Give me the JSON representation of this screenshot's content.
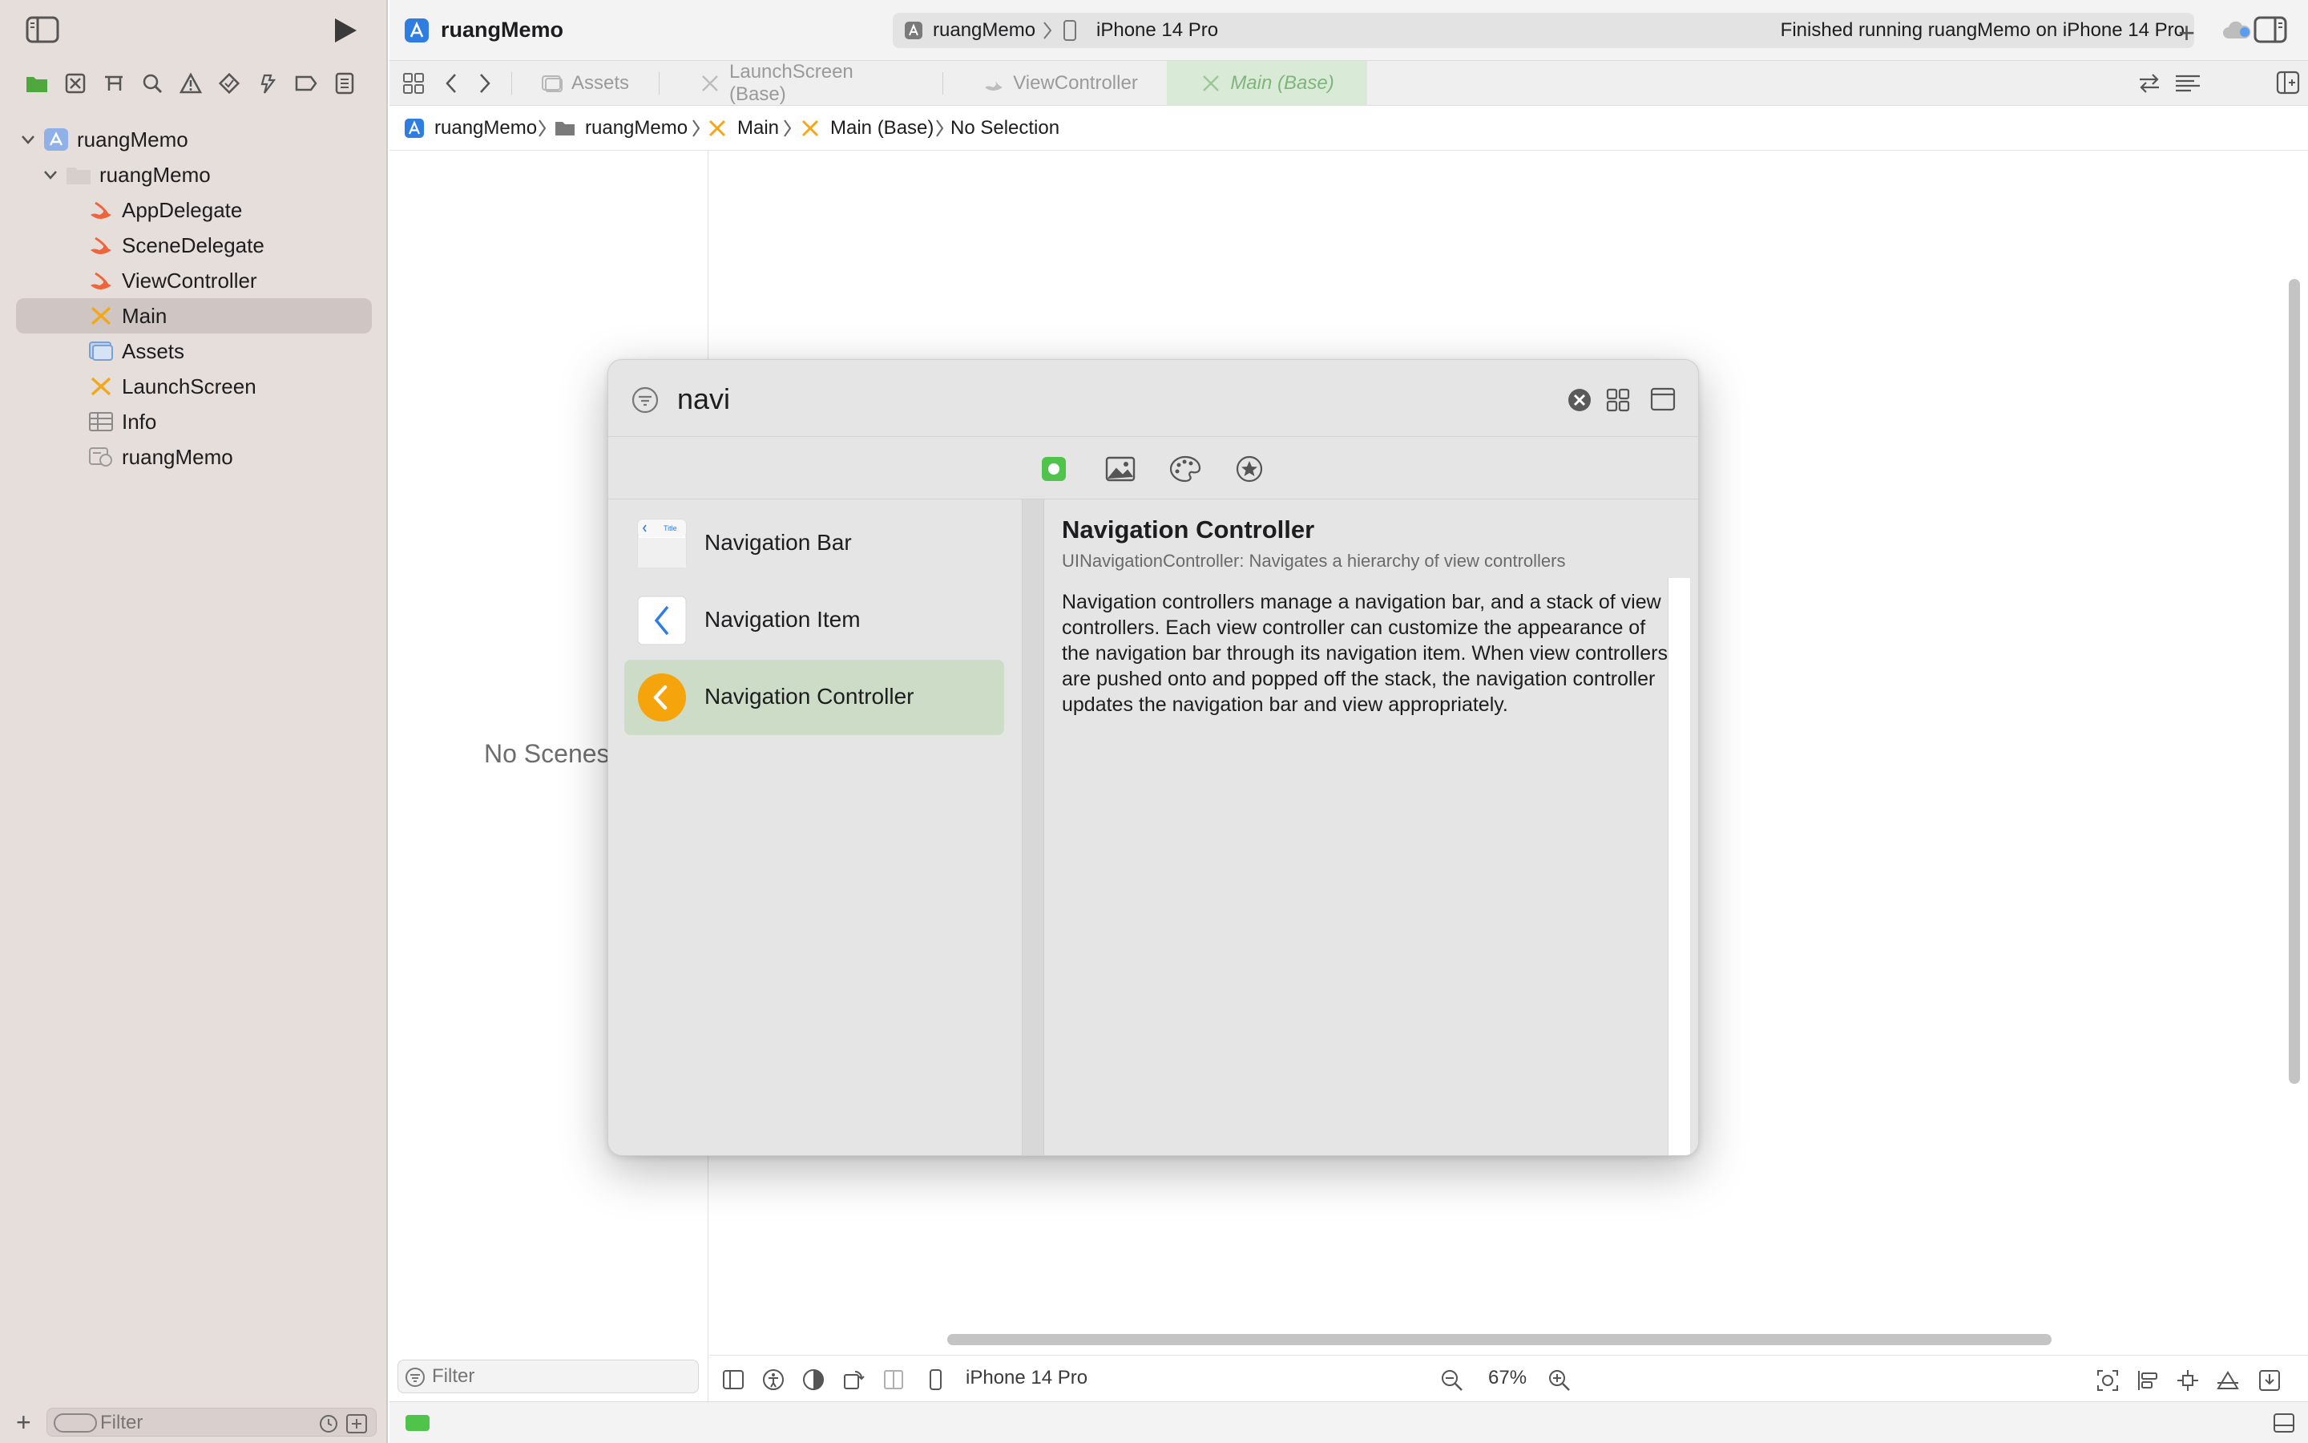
{
  "window": {
    "project_title": "ruangMemo",
    "scheme": {
      "project": "ruangMemo",
      "device": "iPhone 14 Pro",
      "status": "Finished running ruangMemo on iPhone 14 Pro"
    }
  },
  "sidebar": {
    "tree": [
      {
        "label": "ruangMemo",
        "type": "project",
        "expanded": true
      },
      {
        "label": "ruangMemo",
        "type": "folder",
        "expanded": true
      },
      {
        "label": "AppDelegate",
        "type": "swift"
      },
      {
        "label": "SceneDelegate",
        "type": "swift"
      },
      {
        "label": "ViewController",
        "type": "swift"
      },
      {
        "label": "Main",
        "type": "storyboard",
        "selected": true
      },
      {
        "label": "Assets",
        "type": "assets"
      },
      {
        "label": "LaunchScreen",
        "type": "storyboard"
      },
      {
        "label": "Info",
        "type": "plist"
      },
      {
        "label": "ruangMemo",
        "type": "entitlements"
      }
    ],
    "filter_placeholder": "Filter"
  },
  "tabs": [
    {
      "label": "Assets",
      "icon": "assets-icon"
    },
    {
      "label": "LaunchScreen (Base)",
      "icon": "storyboard-icon"
    },
    {
      "label": "ViewController",
      "icon": "swift-icon"
    },
    {
      "label": "Main (Base)",
      "icon": "storyboard-icon",
      "active": true
    }
  ],
  "breadcrumb": {
    "items": [
      {
        "label": "ruangMemo",
        "icon": "app-icon"
      },
      {
        "label": "ruangMemo",
        "icon": "folder-icon"
      },
      {
        "label": "Main",
        "icon": "storyboard-icon"
      },
      {
        "label": "Main (Base)",
        "icon": "storyboard-icon"
      },
      {
        "label": "No Selection",
        "icon": ""
      }
    ]
  },
  "outline": {
    "empty_text": "No Scenes",
    "filter_placeholder": "Filter"
  },
  "canvas_bottom": {
    "device": "iPhone 14 Pro",
    "zoom": "67%"
  },
  "library": {
    "search_value": "navi",
    "items": [
      {
        "label": "Navigation Bar",
        "icon": "navigation-bar-icon",
        "icon_text": "Title"
      },
      {
        "label": "Navigation Item",
        "icon": "navigation-item-icon"
      },
      {
        "label": "Navigation Controller",
        "icon": "navigation-controller-icon",
        "selected": true
      }
    ],
    "detail": {
      "title": "Navigation Controller",
      "subtitle": "UINavigationController: Navigates a hierarchy of view controllers",
      "body": "Navigation controllers manage a navigation bar, and a stack of view controllers. Each view controller can customize the appearance of the navigation bar through its navigation item. When view controllers are pushed onto and popped off the stack, the navigation controller updates the navigation bar and view appropriately."
    }
  },
  "colors": {
    "accent_orange": "#f5a40c",
    "selection_green": "#ccdcc7",
    "status_green": "#4fc34a",
    "swift_orange": "#f0643c",
    "storyboard_yellow": "#f3a81b"
  }
}
